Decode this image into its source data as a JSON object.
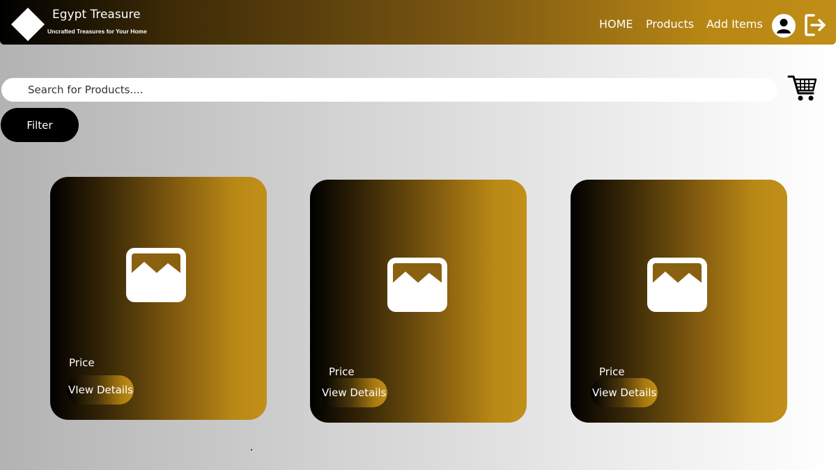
{
  "brand": {
    "title": "Egypt Treasure",
    "tagline": "Uncrafted Treasures for Your Home"
  },
  "nav": {
    "home": "HOME",
    "products": "Products",
    "add_items": "Add Items"
  },
  "icons": {
    "logo": "diamond-logo-icon",
    "account": "user-avatar-icon",
    "logout": "logout-icon",
    "cart": "shopping-cart-icon",
    "product_image": "image-placeholder-icon"
  },
  "search": {
    "placeholder": "Search for Products...."
  },
  "filter": {
    "label": "Filter"
  },
  "products": [
    {
      "price_label": "Price",
      "details_label": "VIew Details"
    },
    {
      "price_label": "Price",
      "details_label": "View Details"
    },
    {
      "price_label": "Price",
      "details_label": "View Details"
    }
  ],
  "colors": {
    "accent_gold": "#c08e18",
    "dark": "#000000",
    "text_light": "#ffffff"
  }
}
